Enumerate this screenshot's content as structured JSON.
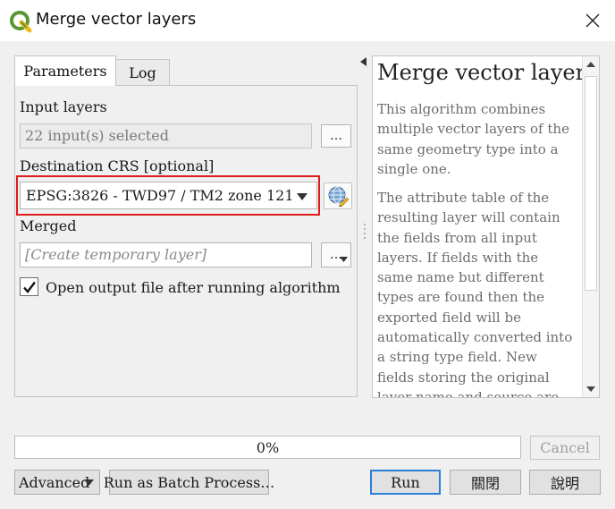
{
  "window": {
    "title": "Merge vector layers",
    "icon": "qgis-logo-icon",
    "close_icon": "close-icon"
  },
  "tabs": [
    {
      "label": "Parameters",
      "active": true
    },
    {
      "label": "Log",
      "active": false
    }
  ],
  "parameters": {
    "input_layers": {
      "label": "Input layers",
      "value": "22 input(s) selected",
      "button_label": "…"
    },
    "destination_crs": {
      "label": "Destination CRS [optional]",
      "value": "EPSG:3826 - TWD97 / TM2 zone 121",
      "selector_icon": "globe-crs-icon"
    },
    "merged": {
      "label": "Merged",
      "placeholder": "[Create temporary layer]",
      "button_label": "…"
    },
    "open_output": {
      "label": "Open output file after running algorithm",
      "checked": true
    }
  },
  "help": {
    "title": "Merge vector layers",
    "paragraphs": [
      "This algorithm combines multiple vector layers of the same geometry type into a single one.",
      "The attribute table of the resulting layer will contain the fields from all input layers. If fields with the same name but different types are found then the exported field will be automatically converted into a string type field. New fields storing the original layer name and source are also added."
    ]
  },
  "progress": {
    "percent": 0,
    "text": "0%"
  },
  "buttons": {
    "cancel": "Cancel",
    "advanced": "Advanced",
    "batch": "Run as Batch Process…",
    "run": "Run",
    "close": "關閉",
    "help": "說明"
  },
  "colors": {
    "highlight": "#dd1c1c",
    "qgis_green": "#589632",
    "qgis_yellow": "#f0b51b",
    "default_button_border": "#2b7fd6",
    "progress_fill": "#06b025"
  }
}
